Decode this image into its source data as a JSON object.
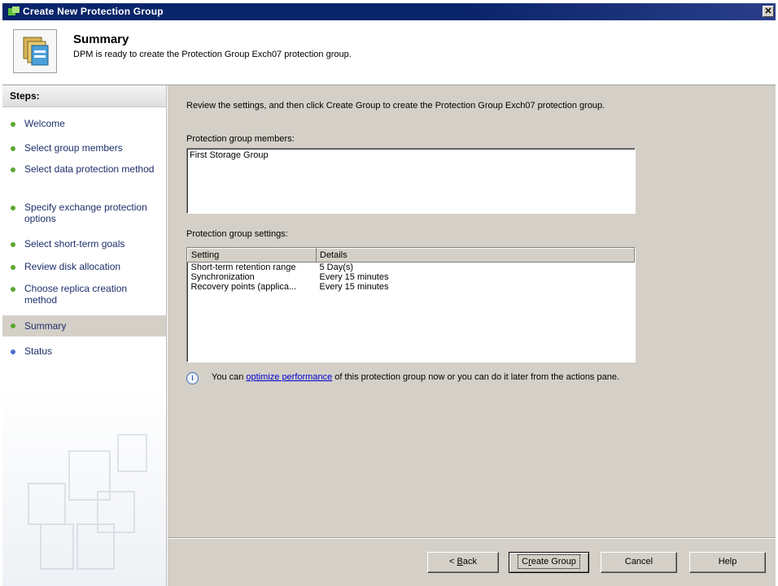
{
  "window": {
    "title": "Create New Protection Group",
    "close_glyph": "✕"
  },
  "header": {
    "heading": "Summary",
    "subtitle": "DPM is ready to create the Protection Group Exch07 protection group."
  },
  "steps": {
    "heading": "Steps:",
    "items": [
      {
        "label": "Welcome",
        "state": "done"
      },
      {
        "label": "Select group members",
        "state": "done"
      },
      {
        "label": "Select data protection method",
        "state": "done"
      },
      {
        "label": "Specify exchange protection options",
        "state": "done"
      },
      {
        "label": "Select short-term goals",
        "state": "done"
      },
      {
        "label": "Review disk allocation",
        "state": "done"
      },
      {
        "label": "Choose replica creation method",
        "state": "done"
      },
      {
        "label": "Summary",
        "state": "current"
      },
      {
        "label": "Status",
        "state": "pending"
      }
    ]
  },
  "main": {
    "intro": "Review the settings, and then click Create Group to create the Protection Group Exch07 protection group.",
    "members_label": "Protection group members:",
    "members": [
      "First Storage Group"
    ],
    "settings_label": "Protection group settings:",
    "settings_columns": [
      "Setting",
      "Details"
    ],
    "settings_rows": [
      [
        "Short-term retention range",
        "5 Day(s)"
      ],
      [
        "Synchronization",
        "Every 15 minutes"
      ],
      [
        "Recovery points (applica...",
        "Every 15 minutes"
      ]
    ],
    "info_before": "You can ",
    "info_link": "optimize performance",
    "info_after": " of this protection group now or you can do it later from the actions pane.",
    "info_icon": "i"
  },
  "buttons": {
    "back": {
      "mnemonic": "B",
      "rest": "ack",
      "prefix": "< "
    },
    "create": {
      "pre": "C",
      "mnemonic": "r",
      "rest": "eate Group"
    },
    "cancel": "Cancel",
    "help": "Help"
  },
  "colors": {
    "titlebar": "#0a246a",
    "panel": "#d4d0c8",
    "step_done": "#5aa832",
    "step_pending": "#4a6fd0",
    "link": "#0000cc"
  }
}
